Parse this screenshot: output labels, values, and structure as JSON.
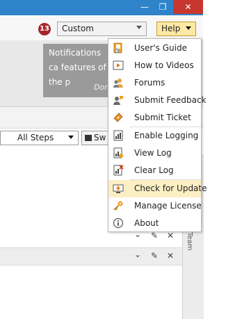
{
  "window": {
    "minimize_glyph": "—",
    "maximize_glyph": "❐",
    "close_glyph": "✕"
  },
  "toolbar": {
    "notification_count": "13",
    "profile_value": "Custom",
    "help_label": "Help"
  },
  "notification": {
    "text": "Notifications ca features of the p",
    "link_text": "Don"
  },
  "filter": {
    "steps_value": "All Steps",
    "switch_label": "Sw"
  },
  "right_panel": {
    "label": "Team"
  },
  "section_rows": [
    {
      "collapse_glyph": "⌄",
      "edit_glyph": "✎",
      "close_glyph": "✕"
    },
    {
      "collapse_glyph": "⌄",
      "edit_glyph": "✎",
      "close_glyph": "✕"
    }
  ],
  "help_menu": {
    "items": [
      {
        "label": "User's Guide",
        "icon": "users-guide-icon"
      },
      {
        "label": "How to Videos",
        "icon": "video-icon"
      },
      {
        "label": "Forums",
        "icon": "forums-icon"
      },
      {
        "label": "Submit Feedback",
        "icon": "feedback-icon"
      },
      {
        "label": "Submit Ticket",
        "icon": "ticket-icon"
      },
      {
        "label": "Enable Logging",
        "icon": "enable-logging-icon"
      },
      {
        "label": "View Log",
        "icon": "view-log-icon"
      },
      {
        "label": "Clear Log",
        "icon": "clear-log-icon"
      },
      {
        "label": "Check for Update",
        "icon": "update-icon",
        "highlighted": true
      },
      {
        "label": "Manage License",
        "icon": "license-key-icon"
      },
      {
        "label": "About",
        "icon": "about-icon"
      }
    ]
  },
  "colors": {
    "titlebar": "#2f83c9",
    "close": "#c8372f",
    "help_button": "#fde9a4",
    "menu_highlight": "#fcefc4",
    "badge": "#a4262c"
  }
}
